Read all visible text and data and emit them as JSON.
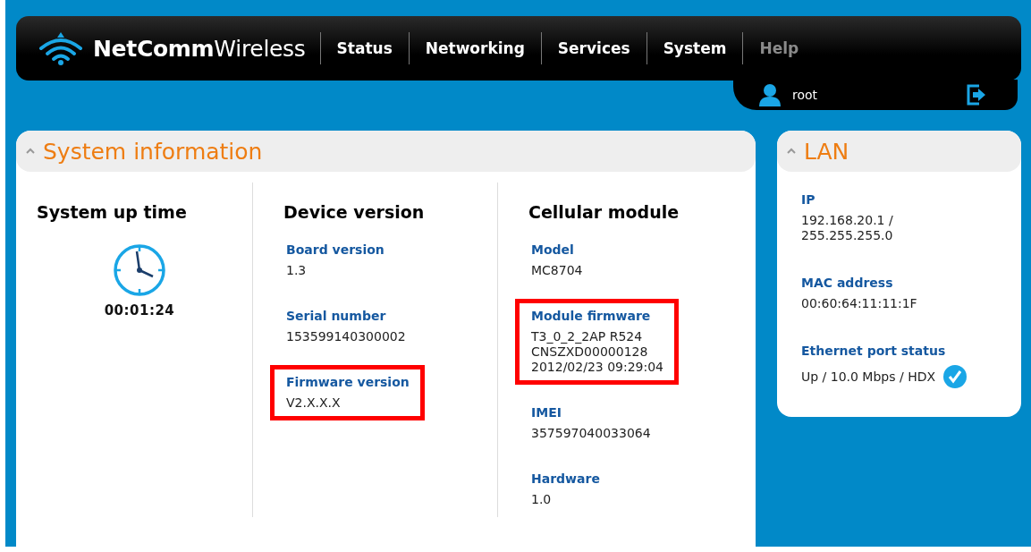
{
  "header": {
    "logo": "**NetComm**Wireless",
    "nav": [
      {
        "label": "Status",
        "disabled": false
      },
      {
        "label": "Networking",
        "disabled": false
      },
      {
        "label": "Services",
        "disabled": false
      },
      {
        "label": "System",
        "disabled": false
      },
      {
        "label": "Help",
        "disabled": true
      }
    ],
    "user": "root"
  },
  "system_information": {
    "title": "System information",
    "expanded": true,
    "uptime": {
      "heading": "System up time",
      "value": "00:01:24"
    },
    "columns": [
      {
        "heading": "Device version",
        "fields": [
          {
            "label": "Board version",
            "value": "1.3",
            "highlighted": false
          },
          {
            "label": "Serial number",
            "value": "153599140300002",
            "highlighted": false
          },
          {
            "label": "Firmware version",
            "value": "V2.X.X.X",
            "highlighted": true
          }
        ]
      },
      {
        "heading": "Cellular module",
        "fields": [
          {
            "label": "Model",
            "value": "MC8704",
            "highlighted": false
          },
          {
            "label": "Module firmware",
            "value": "T3_0_2_2AP R524\nCNSZXD00000128\n2012/02/23 09:29:04",
            "highlighted": true
          },
          {
            "label": "IMEI",
            "value": "357597040033064",
            "highlighted": false
          },
          {
            "label": "Hardware",
            "value": "1.0",
            "highlighted": false
          }
        ]
      }
    ]
  },
  "lan": {
    "title": "LAN",
    "expanded": true,
    "fields": [
      {
        "label": "IP",
        "value": "192.168.20.1 /\n255.255.255.0"
      },
      {
        "label": "MAC address",
        "value": "00:60:64:11:11:1F"
      },
      {
        "label": "Ethernet port status",
        "value": "Up / 10.0 Mbps / HDX",
        "ok": true
      }
    ]
  }
}
